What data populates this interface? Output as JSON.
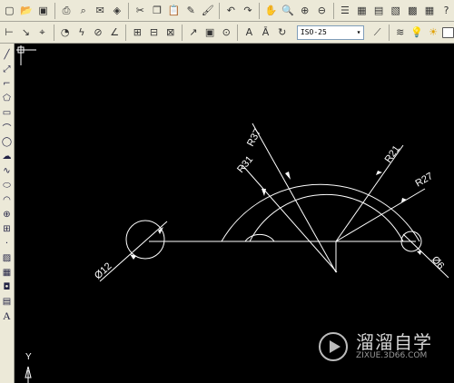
{
  "toolbar_top": {
    "icons": [
      "new-icon",
      "open-icon",
      "save-icon",
      "print-icon",
      "preview-icon",
      "publish-icon",
      "plot-icon",
      "cut-icon",
      "copy-icon",
      "paste-icon",
      "brush-icon",
      "matchprop-icon",
      "undo-icon",
      "redo-icon",
      "pan-icon",
      "zoom-realtime-icon",
      "zoom-window-icon",
      "zoom-previous-icon",
      "properties-icon",
      "designcenter-icon",
      "toolpalettes-icon",
      "sheetset-icon",
      "markup-icon",
      "calculator-icon",
      "help-icon"
    ]
  },
  "toolbar_dim": {
    "text_style_value": "ISO-25",
    "icons": [
      "dim-linear-icon",
      "dim-aligned-icon",
      "dim-ordinate-icon",
      "dim-radius-icon",
      "dim-jogged-icon",
      "dim-diameter-icon",
      "dim-angular-icon",
      "quick-dim-icon",
      "baseline-icon",
      "continue-icon",
      "qleader-icon",
      "tolerance-icon",
      "center-mark-icon",
      "dim-edit-icon",
      "dim-text-edit-icon",
      "dim-update-icon",
      "layer-icon",
      "bulb-icon",
      "sun-icon",
      "color-icon"
    ]
  },
  "draw_toolbar": {
    "tools": [
      "line",
      "construction-line",
      "polyline",
      "polygon",
      "rectangle",
      "arc",
      "circle",
      "revision-cloud",
      "spline",
      "ellipse",
      "ellipse-arc",
      "insert-block",
      "make-block",
      "point",
      "hatch",
      "gradient",
      "region",
      "table",
      "multiline-text"
    ]
  },
  "drawing": {
    "dimensions": [
      "R37",
      "R31",
      "R21",
      "R27",
      "Ø12",
      "Ø6"
    ],
    "ucs_axis_label": "Y"
  },
  "watermark": {
    "title": "溜溜自学",
    "subtitle": "ZIXUE.3D66.COM"
  }
}
